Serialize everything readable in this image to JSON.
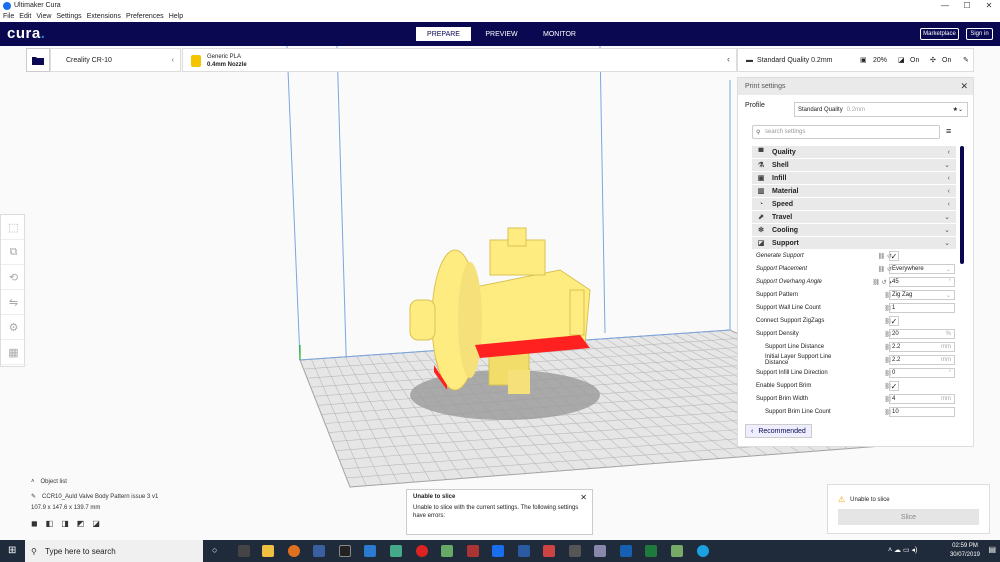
{
  "window": {
    "title": "Ultimaker Cura"
  },
  "menu": [
    "File",
    "Edit",
    "View",
    "Settings",
    "Extensions",
    "Preferences",
    "Help"
  ],
  "header": {
    "logo": "cura",
    "stages": [
      "PREPARE",
      "PREVIEW",
      "MONITOR"
    ],
    "active_stage": "PREPARE",
    "marketplace": "Marketplace",
    "signin": "Sign in"
  },
  "machine": {
    "name": "Creality CR-10"
  },
  "material": {
    "name": "Generic PLA",
    "nozzle": "0.4mm Nozzle"
  },
  "quality_bar": {
    "profile": "Standard Quality 0.2mm",
    "infill": "20%",
    "support": "On",
    "adhesion": "On"
  },
  "print_settings": {
    "title": "Print settings",
    "profile_label": "Profile",
    "profile_value": "Standard Quality",
    "profile_suffix": "0.2mm",
    "search_placeholder": "search settings",
    "categories": [
      {
        "label": "Quality",
        "icon": "quality-icon"
      },
      {
        "label": "Shell",
        "icon": "shell-icon"
      },
      {
        "label": "Infill",
        "icon": "infill-icon"
      },
      {
        "label": "Material",
        "icon": "material-icon"
      },
      {
        "label": "Speed",
        "icon": "speed-icon"
      },
      {
        "label": "Travel",
        "icon": "travel-icon"
      },
      {
        "label": "Cooling",
        "icon": "cooling-icon"
      },
      {
        "label": "Support",
        "icon": "support-icon"
      }
    ],
    "settings": [
      {
        "label": "Generate Support",
        "type": "check",
        "value": "✓"
      },
      {
        "label": "Support Placement",
        "type": "select",
        "value": "Everywhere"
      },
      {
        "label": "Support Overhang Angle",
        "type": "input",
        "value": "45",
        "unit": "°"
      },
      {
        "label": "Support Pattern",
        "type": "select",
        "value": "Zig Zag"
      },
      {
        "label": "Support Wall Line Count",
        "type": "input",
        "value": "1",
        "unit": ""
      },
      {
        "label": "Connect Support ZigZags",
        "type": "check",
        "value": "✓"
      },
      {
        "label": "Support Density",
        "type": "input",
        "value": "20",
        "unit": "%"
      },
      {
        "label": "Support Line Distance",
        "type": "input",
        "value": "2.2",
        "unit": "mm"
      },
      {
        "label": "Initial Layer Support Line Distance",
        "type": "input",
        "value": "2.2",
        "unit": "mm"
      },
      {
        "label": "Support Infill Line Direction",
        "type": "input",
        "value": "0",
        "unit": "°"
      },
      {
        "label": "Enable Support Brim",
        "type": "check",
        "value": "✓"
      },
      {
        "label": "Support Brim Width",
        "type": "input",
        "value": "4",
        "unit": "mm"
      },
      {
        "label": "Support Brim Line Count",
        "type": "input",
        "value": "10",
        "unit": ""
      }
    ],
    "recommended": "Recommended"
  },
  "object": {
    "list_label": "Object list",
    "filename": "CCR10_Auld Valve Body Pattern issue 3 v1",
    "dimensions": "107.9 x 147.6 x 139.7 mm"
  },
  "error": {
    "title": "Unable to slice",
    "message": "Unable to slice with the current settings. The following settings have errors:"
  },
  "slice": {
    "status": "Unable to slice",
    "button": "Slice"
  },
  "taskbar": {
    "search_placeholder": "Type here to search",
    "time": "02:59 PM",
    "date": "30/07/2019"
  },
  "colors": {
    "header": "#0a0850",
    "model": "#ffec80",
    "overhang": "#ff2020",
    "grid": "#b9b9b9"
  }
}
